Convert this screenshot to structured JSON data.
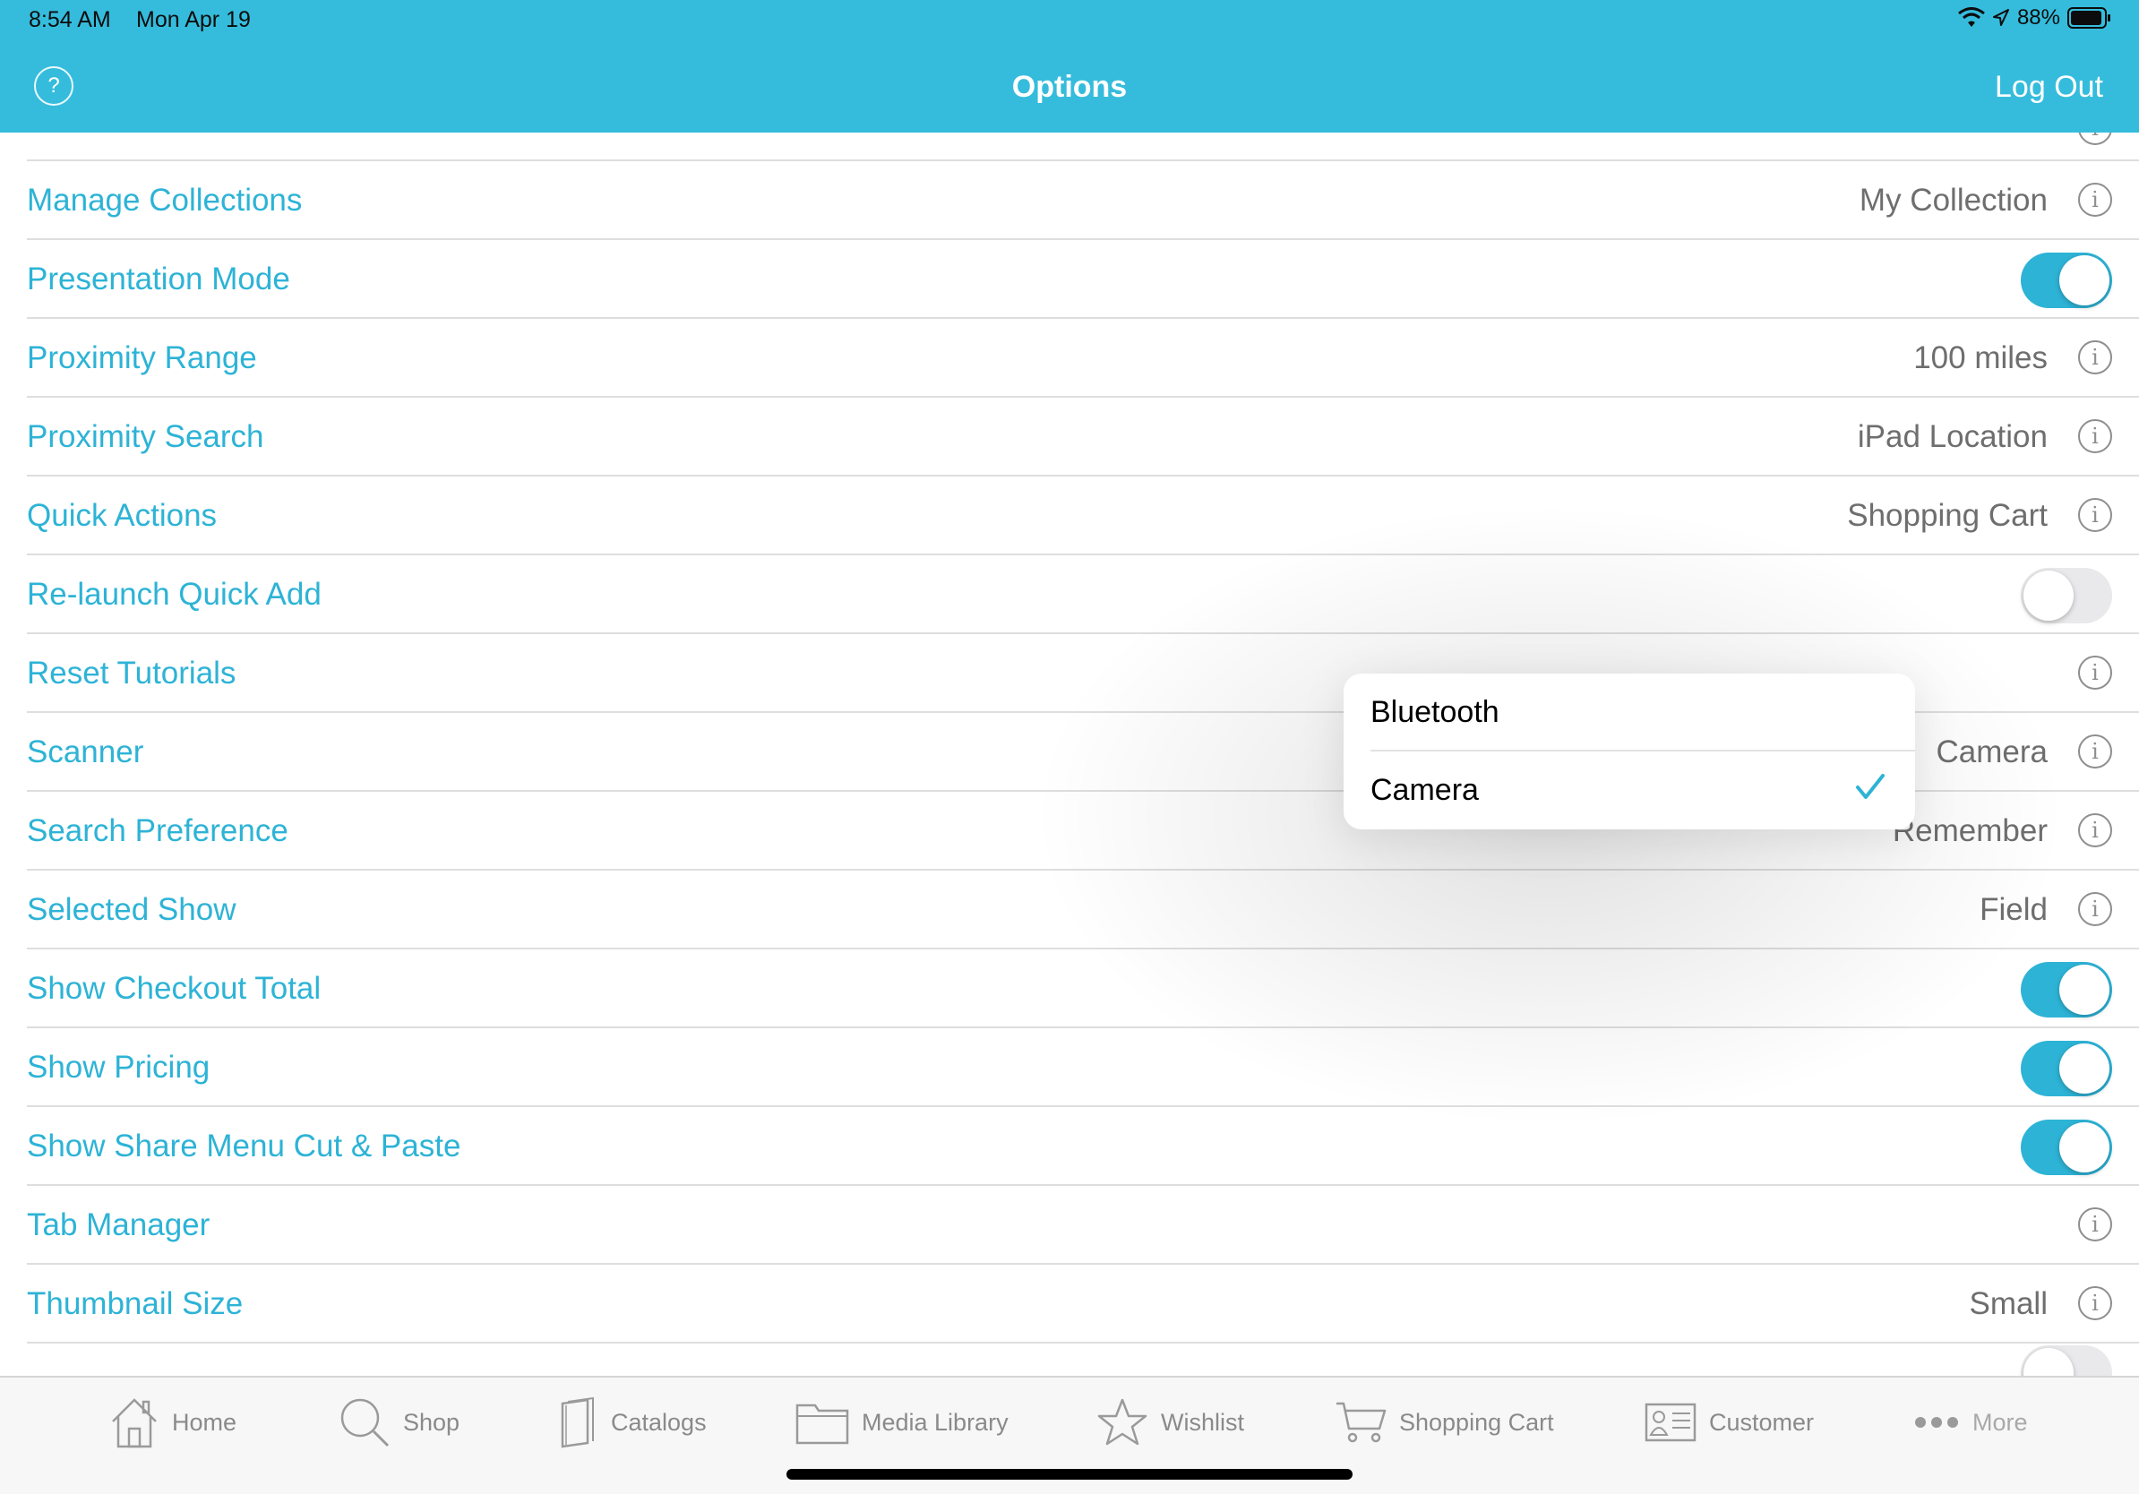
{
  "status_bar": {
    "time": "8:54 AM",
    "date": "Mon Apr 19",
    "battery": "88%"
  },
  "header": {
    "title": "Options",
    "logout_label": "Log Out",
    "help_icon_text": "?"
  },
  "rows": [
    {
      "label": "Manage Collections",
      "value": "My Collection",
      "kind": "value"
    },
    {
      "label": "Presentation Mode",
      "value": "",
      "kind": "toggle",
      "on": true
    },
    {
      "label": "Proximity Range",
      "value": "100 miles",
      "kind": "value"
    },
    {
      "label": "Proximity Search",
      "value": "iPad Location",
      "kind": "value"
    },
    {
      "label": "Quick Actions",
      "value": "Shopping Cart",
      "kind": "value"
    },
    {
      "label": "Re-launch Quick Add",
      "value": "",
      "kind": "toggle",
      "on": false
    },
    {
      "label": "Reset Tutorials",
      "value": "",
      "kind": "info"
    },
    {
      "label": "Scanner",
      "value": "Camera",
      "kind": "value"
    },
    {
      "label": "Search Preference",
      "value": "Remember",
      "kind": "value"
    },
    {
      "label": "Selected Show",
      "value": "Field",
      "kind": "value"
    },
    {
      "label": "Show Checkout Total",
      "value": "",
      "kind": "toggle",
      "on": true
    },
    {
      "label": "Show Pricing",
      "value": "",
      "kind": "toggle",
      "on": true
    },
    {
      "label": "Show Share Menu Cut & Paste",
      "value": "",
      "kind": "toggle",
      "on": true
    },
    {
      "label": "Tab Manager",
      "value": "",
      "kind": "info"
    },
    {
      "label": "Thumbnail Size",
      "value": "Small",
      "kind": "value"
    }
  ],
  "info_glyph": "i",
  "scanner_popover": {
    "options": [
      "Bluetooth",
      "Camera"
    ],
    "selected": "Camera"
  },
  "tabbar": {
    "tabs": [
      {
        "label": "Home",
        "icon": "home-icon"
      },
      {
        "label": "Shop",
        "icon": "search-icon"
      },
      {
        "label": "Catalogs",
        "icon": "catalog-icon"
      },
      {
        "label": "Media Library",
        "icon": "folder-icon"
      },
      {
        "label": "Wishlist",
        "icon": "star-icon"
      },
      {
        "label": "Shopping Cart",
        "icon": "cart-icon"
      },
      {
        "label": "Customer",
        "icon": "customer-card-icon"
      },
      {
        "label": "More",
        "icon": "more-dots-icon"
      }
    ]
  },
  "colors": {
    "accent": "#35BCDC",
    "label_blue": "#2DB3D6",
    "value_gray": "#6E6E6E",
    "tab_gray": "#8A8A8A"
  }
}
